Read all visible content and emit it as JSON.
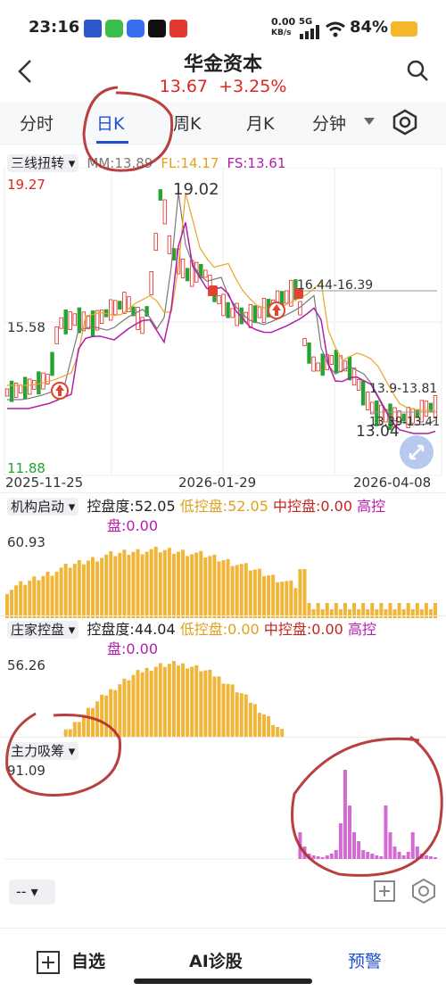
{
  "status": {
    "time": "23:16",
    "net_speed": "0.00",
    "net_unit": "KB/s",
    "signal": "5G",
    "battery": "84%"
  },
  "header": {
    "title": "华金资本",
    "price": "13.67",
    "change": "+3.25%"
  },
  "tabs": [
    "分时",
    "日K",
    "周K",
    "月K",
    "分钟"
  ],
  "kline": {
    "ind_name": "三线扭转",
    "mm": "MM:13.89",
    "fl": "FL:14.17",
    "fs": "FS:13.61",
    "y_high": "19.27",
    "y_mid": "15.58",
    "y_low": "11.88",
    "peak": "19.02",
    "range1": "16.44-16.39",
    "range2": "13.9-13.81",
    "range3": "13.39-13.41",
    "low_mark": "13.04",
    "dates": [
      "2025-11-25",
      "2026-01-29",
      "2026-04-08"
    ],
    "colors": {
      "up": "#e0261f",
      "down": "#22a531",
      "mm": "#7a7a7a",
      "fl": "#e7a72a",
      "fs": "#b21ea8"
    }
  },
  "panel1": {
    "name": "机构启动",
    "v1": "控盘度:52.05",
    "v2": "低控盘:52.05",
    "v3": "中控盘:0.00",
    "v4": "高控",
    "v4b": "盘:0.00",
    "ymax": "60.93"
  },
  "panel2": {
    "name": "庄家控盘",
    "v1": "控盘度:44.04",
    "v2": "低控盘:0.00",
    "v3": "中控盘:0.00",
    "v4": "高控",
    "v4b": "盘:0.00",
    "ymax": "56.26"
  },
  "panel3": {
    "name": "主力吸筹",
    "ymax": "91.09"
  },
  "bottom_tool": {
    "select": "--"
  },
  "nav": {
    "items": [
      "自选",
      "AI诊股",
      "预警"
    ]
  }
}
